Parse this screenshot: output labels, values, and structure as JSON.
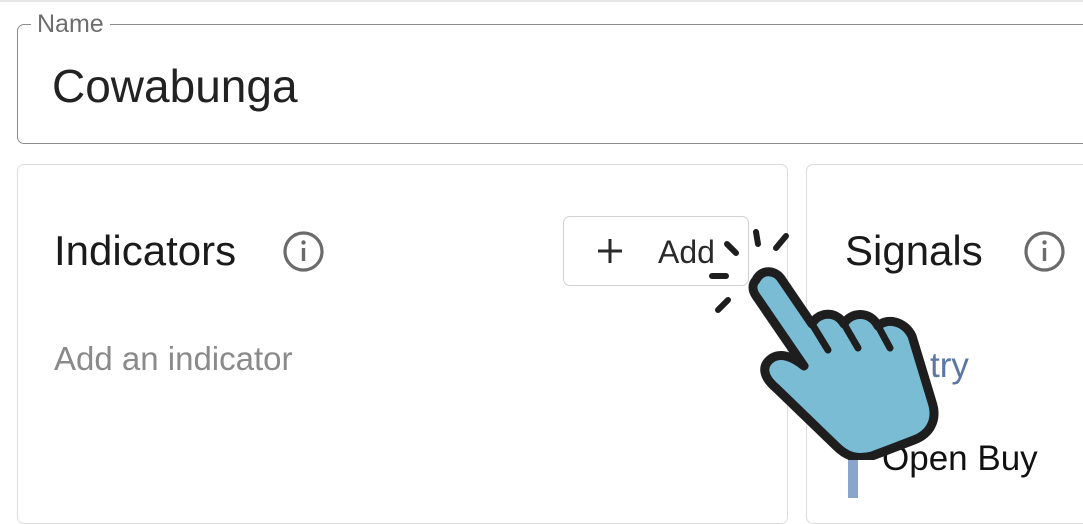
{
  "name_field": {
    "legend": "Name",
    "value": "Cowabunga"
  },
  "indicators": {
    "title": "Indicators",
    "add_label": "Add",
    "empty_placeholder": "Add an indicator"
  },
  "signals": {
    "title": "Signals",
    "section_link": "try",
    "items": [
      {
        "label": "Open Buy"
      }
    ]
  },
  "icons": {
    "info": "info-icon",
    "add": "plus-icon",
    "cursor": "hand-pointer-icon"
  },
  "colors": {
    "link": "#5a77a6",
    "accent_bar": "#8aa5cc",
    "cursor_fill": "#7bbcd5"
  }
}
